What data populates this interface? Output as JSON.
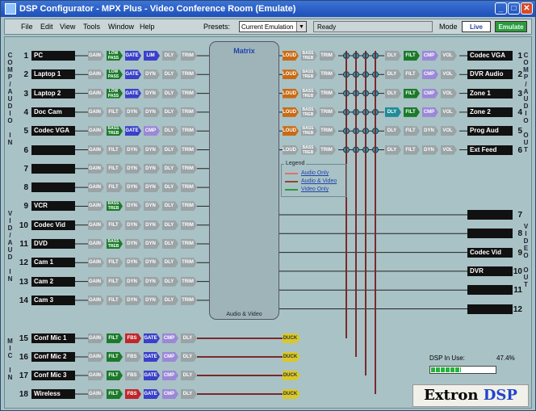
{
  "window": {
    "title": "DSP Configurator - MPX Plus - Video Conference Room (Emulate)"
  },
  "menu": {
    "items": [
      "File",
      "Edit",
      "View",
      "Tools",
      "Window",
      "Help"
    ]
  },
  "toolbar": {
    "presets_label": "Presets:",
    "presets_value": "Current Emulation",
    "status": "Ready",
    "mode_label": "Mode",
    "live_label": "Live",
    "emulate_label": "Emulate"
  },
  "side_labels": {
    "comp_audio_in": "COMP/AUDIO IN",
    "vid_aud_in": "VID/AUD IN",
    "mic_in": "MIC IN",
    "comp_audio_out": "COMP/AUDIO OUT",
    "video_out": "VIDEO OUT"
  },
  "inputs": [
    {
      "num": "1",
      "name": "PC",
      "chain": [
        [
          "GAIN",
          "gray"
        ],
        [
          "LOW PASS",
          "green"
        ],
        [
          "GATE",
          "blue"
        ],
        [
          "LIM",
          "blue"
        ],
        [
          "DLY",
          "gray"
        ],
        [
          "TRIM",
          "gray"
        ]
      ]
    },
    {
      "num": "2",
      "name": "Laptop 1",
      "chain": [
        [
          "GAIN",
          "gray"
        ],
        [
          "LOW PASS",
          "green"
        ],
        [
          "GATE",
          "blue"
        ],
        [
          "DYN",
          "gray"
        ],
        [
          "DLY",
          "gray"
        ],
        [
          "TRIM",
          "gray"
        ]
      ]
    },
    {
      "num": "3",
      "name": "Laptop 2",
      "chain": [
        [
          "GAIN",
          "gray"
        ],
        [
          "LOW PASS",
          "green"
        ],
        [
          "GATE",
          "blue"
        ],
        [
          "DYN",
          "gray"
        ],
        [
          "DLY",
          "gray"
        ],
        [
          "TRIM",
          "gray"
        ]
      ]
    },
    {
      "num": "4",
      "name": "Doc Cam",
      "chain": [
        [
          "GAIN",
          "gray"
        ],
        [
          "FILT",
          "gray"
        ],
        [
          "DYN",
          "gray"
        ],
        [
          "DYN",
          "gray"
        ],
        [
          "DLY",
          "gray"
        ],
        [
          "TRIM",
          "gray"
        ]
      ]
    },
    {
      "num": "5",
      "name": "Codec VGA",
      "chain": [
        [
          "GAIN",
          "gray"
        ],
        [
          "BASS TREB",
          "green"
        ],
        [
          "GATE",
          "blue"
        ],
        [
          "CMP",
          "purple"
        ],
        [
          "DLY",
          "gray"
        ],
        [
          "TRIM",
          "gray"
        ]
      ]
    },
    {
      "num": "6",
      "name": "",
      "chain": [
        [
          "GAIN",
          "gray"
        ],
        [
          "FILT",
          "gray"
        ],
        [
          "DYN",
          "gray"
        ],
        [
          "DYN",
          "gray"
        ],
        [
          "DLY",
          "gray"
        ],
        [
          "TRIM",
          "gray"
        ]
      ]
    },
    {
      "num": "7",
      "name": "",
      "chain": [
        [
          "GAIN",
          "gray"
        ],
        [
          "FILT",
          "gray"
        ],
        [
          "DYN",
          "gray"
        ],
        [
          "DYN",
          "gray"
        ],
        [
          "DLY",
          "gray"
        ],
        [
          "TRIM",
          "gray"
        ]
      ]
    },
    {
      "num": "8",
      "name": "",
      "chain": [
        [
          "GAIN",
          "gray"
        ],
        [
          "FILT",
          "gray"
        ],
        [
          "DYN",
          "gray"
        ],
        [
          "DYN",
          "gray"
        ],
        [
          "DLY",
          "gray"
        ],
        [
          "TRIM",
          "gray"
        ]
      ]
    },
    {
      "num": "9",
      "name": "VCR",
      "chain": [
        [
          "GAIN",
          "gray"
        ],
        [
          "BASS TREB",
          "green"
        ],
        [
          "DYN",
          "gray"
        ],
        [
          "DYN",
          "gray"
        ],
        [
          "DLY",
          "gray"
        ],
        [
          "TRIM",
          "gray"
        ]
      ]
    },
    {
      "num": "10",
      "name": "Codec Vid",
      "chain": [
        [
          "GAIN",
          "gray"
        ],
        [
          "FILT",
          "gray"
        ],
        [
          "DYN",
          "gray"
        ],
        [
          "DYN",
          "gray"
        ],
        [
          "DLY",
          "gray"
        ],
        [
          "TRIM",
          "gray"
        ]
      ]
    },
    {
      "num": "11",
      "name": "DVD",
      "chain": [
        [
          "GAIN",
          "gray"
        ],
        [
          "BASS TREB",
          "green"
        ],
        [
          "DYN",
          "gray"
        ],
        [
          "DYN",
          "gray"
        ],
        [
          "DLY",
          "gray"
        ],
        [
          "TRIM",
          "gray"
        ]
      ]
    },
    {
      "num": "12",
      "name": "Cam 1",
      "chain": [
        [
          "GAIN",
          "gray"
        ],
        [
          "FILT",
          "gray"
        ],
        [
          "DYN",
          "gray"
        ],
        [
          "DYN",
          "gray"
        ],
        [
          "DLY",
          "gray"
        ],
        [
          "TRIM",
          "gray"
        ]
      ]
    },
    {
      "num": "13",
      "name": "Cam 2",
      "chain": [
        [
          "GAIN",
          "gray"
        ],
        [
          "FILT",
          "gray"
        ],
        [
          "DYN",
          "gray"
        ],
        [
          "DYN",
          "gray"
        ],
        [
          "DLY",
          "gray"
        ],
        [
          "TRIM",
          "gray"
        ]
      ]
    },
    {
      "num": "14",
      "name": "Cam 3",
      "chain": [
        [
          "GAIN",
          "gray"
        ],
        [
          "FILT",
          "gray"
        ],
        [
          "DYN",
          "gray"
        ],
        [
          "DYN",
          "gray"
        ],
        [
          "DLY",
          "gray"
        ],
        [
          "TRIM",
          "gray"
        ]
      ]
    }
  ],
  "mics": [
    {
      "num": "15",
      "name": "Conf Mic 1",
      "chain": [
        [
          "GAIN",
          "gray"
        ],
        [
          "FILT",
          "green"
        ],
        [
          "FBS",
          "red"
        ],
        [
          "GATE",
          "blue"
        ],
        [
          "CMP",
          "purple"
        ],
        [
          "DLY",
          "gray"
        ]
      ]
    },
    {
      "num": "16",
      "name": "Conf Mic 2",
      "chain": [
        [
          "GAIN",
          "gray"
        ],
        [
          "FILT",
          "green"
        ],
        [
          "FBS",
          "gray"
        ],
        [
          "GATE",
          "blue"
        ],
        [
          "CMP",
          "purple"
        ],
        [
          "DLY",
          "gray"
        ]
      ]
    },
    {
      "num": "17",
      "name": "Conf Mic 3",
      "chain": [
        [
          "GAIN",
          "gray"
        ],
        [
          "FILT",
          "green"
        ],
        [
          "FBS",
          "gray"
        ],
        [
          "GATE",
          "blue"
        ],
        [
          "CMP",
          "purple"
        ],
        [
          "DLY",
          "gray"
        ]
      ]
    },
    {
      "num": "18",
      "name": "Wireless",
      "chain": [
        [
          "GAIN",
          "gray"
        ],
        [
          "FILT",
          "green"
        ],
        [
          "FBS",
          "red"
        ],
        [
          "GATE",
          "blue"
        ],
        [
          "CMP",
          "purple"
        ],
        [
          "DLY",
          "gray"
        ]
      ]
    }
  ],
  "matrix": {
    "title": "Matrix",
    "footer": "Audio & Video"
  },
  "legend": {
    "title": "Legend",
    "items": [
      {
        "label": "Audio Only",
        "color": "#e07070"
      },
      {
        "label": "Audio & Video",
        "color": "#8a4a2a"
      },
      {
        "label": "Video Only",
        "color": "#2a9a3a"
      }
    ]
  },
  "outputs": [
    {
      "num": "1",
      "name": "Codec VGA",
      "pre": [
        [
          "LOUD",
          "orange"
        ],
        [
          "BASS TREB",
          "gray"
        ],
        [
          "TRIM",
          "gray"
        ]
      ],
      "post": [
        [
          "DLY",
          "gray"
        ],
        [
          "FILT",
          "green"
        ],
        [
          "CMP",
          "purple"
        ],
        [
          "VOL",
          "gray"
        ]
      ]
    },
    {
      "num": "2",
      "name": "DVR Audio",
      "pre": [
        [
          "LOUD",
          "orange"
        ],
        [
          "BASS TREB",
          "gray"
        ],
        [
          "TRIM",
          "gray"
        ]
      ],
      "post": [
        [
          "DLY",
          "gray"
        ],
        [
          "FILT",
          "gray"
        ],
        [
          "CMP",
          "purple"
        ],
        [
          "VOL",
          "gray"
        ]
      ]
    },
    {
      "num": "3",
      "name": "Zone 1",
      "pre": [
        [
          "LOUD",
          "orange"
        ],
        [
          "BASS TREB",
          "gray"
        ],
        [
          "TRIM",
          "gray"
        ]
      ],
      "post": [
        [
          "DLY",
          "gray"
        ],
        [
          "FILT",
          "green"
        ],
        [
          "CMP",
          "purple"
        ],
        [
          "VOL",
          "gray"
        ]
      ]
    },
    {
      "num": "4",
      "name": "Zone 2",
      "pre": [
        [
          "LOUD",
          "orange"
        ],
        [
          "BASS TREB",
          "gray"
        ],
        [
          "TRIM",
          "gray"
        ]
      ],
      "post": [
        [
          "DLY",
          "teal"
        ],
        [
          "FILT",
          "green"
        ],
        [
          "CMP",
          "purple"
        ],
        [
          "VOL",
          "gray"
        ]
      ]
    },
    {
      "num": "5",
      "name": "Prog Aud",
      "pre": [
        [
          "LOUD",
          "orange"
        ],
        [
          "BASS TREB",
          "gray"
        ],
        [
          "TRIM",
          "gray"
        ]
      ],
      "post": [
        [
          "DLY",
          "gray"
        ],
        [
          "FILT",
          "gray"
        ],
        [
          "DYN",
          "gray"
        ],
        [
          "VOL",
          "gray"
        ]
      ]
    },
    {
      "num": "6",
      "name": "Ext Feed",
      "pre": [
        [
          "LOUD",
          "gray"
        ],
        [
          "BASS TREB",
          "gray"
        ],
        [
          "TRIM",
          "gray"
        ]
      ],
      "post": [
        [
          "DLY",
          "gray"
        ],
        [
          "FILT",
          "gray"
        ],
        [
          "DYN",
          "gray"
        ],
        [
          "VOL",
          "gray"
        ]
      ]
    }
  ],
  "video_outputs": [
    {
      "num": "7",
      "name": ""
    },
    {
      "num": "8",
      "name": ""
    },
    {
      "num": "9",
      "name": "Codec Vid"
    },
    {
      "num": "10",
      "name": "DVR"
    },
    {
      "num": "11",
      "name": ""
    },
    {
      "num": "12",
      "name": ""
    }
  ],
  "duck_label": "DUCK",
  "meter": {
    "label": "DSP In Use:",
    "percent_text": "47.4%",
    "fraction": 0.474
  },
  "logo": {
    "brand": "Extron",
    "product": "DSP"
  }
}
